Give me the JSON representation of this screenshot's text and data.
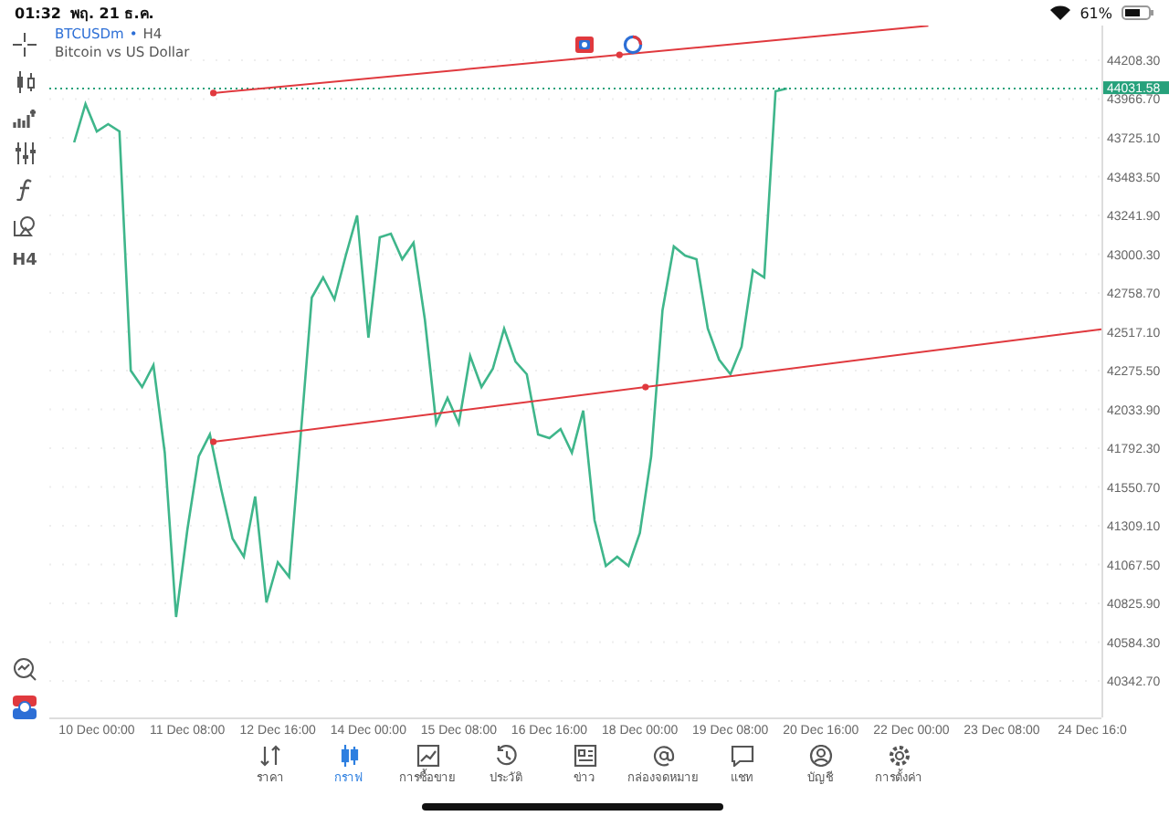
{
  "status_bar": {
    "time": "01:32",
    "date": "พฤ. 21 ธ.ค.",
    "battery": "61%"
  },
  "toolbar": {
    "timeframe": "H4"
  },
  "symbol": {
    "name": "BTCUSDm",
    "separator": "•",
    "timeframe": "H4",
    "description": "Bitcoin vs US Dollar"
  },
  "chart": {
    "chart_data": {
      "type": "line",
      "categories": [
        null,
        null,
        null,
        null,
        "10 Dec 00:00",
        null,
        null,
        null,
        null,
        null,
        null,
        null,
        "11 Dec 08:00",
        null,
        null,
        null,
        null,
        null,
        null,
        null,
        "12 Dec 16:00",
        null,
        null,
        null,
        null,
        null,
        null,
        null,
        "14 Dec 00:00",
        null,
        null,
        null,
        null,
        null,
        null,
        null,
        "15 Dec 08:00",
        null,
        null,
        null,
        null,
        null,
        null,
        null,
        "16 Dec 16:00",
        null,
        null,
        null,
        null,
        null,
        null,
        null,
        "18 Dec 00:00",
        null,
        null,
        null,
        null,
        null,
        null,
        null,
        "19 Dec 08:00",
        null,
        null,
        null,
        null,
        null,
        null,
        null,
        "20 Dec 16:00",
        null,
        null,
        null,
        null,
        null,
        null,
        null,
        "22 Dec 00:00",
        null,
        null,
        null,
        null,
        null,
        null,
        null,
        "23 Dec 08:00",
        null,
        null,
        null,
        null,
        null,
        null,
        null,
        "24 Dec 16:0"
      ],
      "series": [
        {
          "color": "#3fb68b",
          "values": [
            null,
            null,
            43697,
            43935,
            43765,
            43810,
            43765,
            42276,
            42173,
            42310,
            41764,
            40741,
            41287,
            41741,
            41878,
            41537,
            41230,
            41116,
            41491,
            40832,
            41082,
            40991,
            41855,
            42730,
            42855,
            42719,
            42992,
            43242,
            42480,
            43106,
            43128,
            42969,
            43071,
            42594,
            41946,
            42105,
            41946,
            42367,
            42173,
            42287,
            42537,
            42332,
            42253,
            41878,
            41855,
            41912,
            41764,
            42026,
            41343,
            41059,
            41116,
            41059,
            41264,
            41741,
            42651,
            43049,
            42992,
            42969,
            42537,
            42344,
            42253,
            42423,
            42901,
            42855,
            44015,
            44032,
            null,
            null,
            null,
            null,
            null,
            null,
            null,
            null,
            null,
            null,
            null,
            null,
            null,
            null,
            null,
            null,
            null,
            null,
            null,
            null,
            null,
            null,
            null,
            null,
            null,
            null,
            null
          ]
        }
      ],
      "ylim": [
        40126.8,
        44424.3
      ],
      "grid": true,
      "yticks": [
        {
          "value": 44208.3,
          "label": "44208.30"
        },
        {
          "value": 43966.7,
          "label": "43966.70"
        },
        {
          "value": 43725.1,
          "label": "43725.10"
        },
        {
          "value": 43483.5,
          "label": "43483.50"
        },
        {
          "value": 43241.9,
          "label": "43241.90"
        },
        {
          "value": 43000.3,
          "label": "43000.30"
        },
        {
          "value": 42758.7,
          "label": "42758.70"
        },
        {
          "value": 42517.1,
          "label": "42517.10"
        },
        {
          "value": 42275.5,
          "label": "42275.50"
        },
        {
          "value": 42033.9,
          "label": "42033.90"
        },
        {
          "value": 41792.3,
          "label": "41792.30"
        },
        {
          "value": 41550.7,
          "label": "41550.70"
        },
        {
          "value": 41309.1,
          "label": "41309.10"
        },
        {
          "value": 41067.5,
          "label": "41067.50"
        },
        {
          "value": 40825.9,
          "label": "40825.90"
        },
        {
          "value": 40584.3,
          "label": "40584.30"
        },
        {
          "value": 40342.7,
          "label": "40342.70"
        }
      ]
    },
    "current_price": {
      "label": "44031.58"
    }
  },
  "tab_bar": [
    {
      "label": "ราคา",
      "selected": false
    },
    {
      "label": "กราฟ",
      "selected": true
    },
    {
      "label": "การซื้อขาย",
      "selected": false
    },
    {
      "label": "ประวัติ",
      "selected": false
    },
    {
      "label": "ข่าว",
      "selected": false
    },
    {
      "label": "กล่องจดหมาย",
      "selected": false
    },
    {
      "label": "แชท",
      "selected": false
    },
    {
      "label": "บัญชี",
      "selected": false
    },
    {
      "label": "การตั้งค่า",
      "selected": false
    }
  ]
}
